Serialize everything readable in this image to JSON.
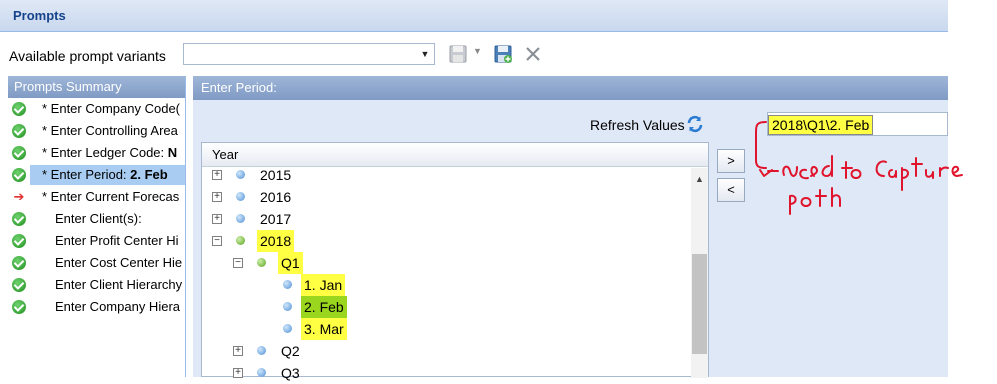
{
  "window": {
    "title": "Prompts"
  },
  "toolbar": {
    "variants_label": "Available prompt variants",
    "variant_value": "",
    "icons": [
      "save-icon",
      "dropdown-arrow-icon",
      "save-as-icon",
      "delete-icon"
    ]
  },
  "summary": {
    "header": "Prompts Summary",
    "items": [
      {
        "status": "ok",
        "label": "* Enter Company Code(",
        "value": ""
      },
      {
        "status": "ok",
        "label": "* Enter Controlling Area",
        "value": ""
      },
      {
        "status": "ok",
        "label": "* Enter Ledger Code: ",
        "value": "N"
      },
      {
        "status": "ok",
        "label": "* Enter Period: ",
        "value": "2. Feb"
      },
      {
        "status": "arrow",
        "label": "* Enter Current Forecas",
        "value": ""
      },
      {
        "status": "ok",
        "label": "Enter Client(s):",
        "value": ""
      },
      {
        "status": "ok",
        "label": "Enter Profit Center Hi",
        "value": ""
      },
      {
        "status": "ok",
        "label": "Enter Cost Center Hie",
        "value": ""
      },
      {
        "status": "ok",
        "label": "Enter Client Hierarchy",
        "value": ""
      },
      {
        "status": "ok",
        "label": "Enter Company Hiera",
        "value": ""
      }
    ]
  },
  "period": {
    "header": "Enter Period:",
    "refresh_label": "Refresh Values",
    "selected_path": "2018\\Q1\\2. Feb",
    "tree_header": "Year",
    "tree": [
      {
        "label": "2015",
        "level": 0,
        "expander": "+"
      },
      {
        "label": "2016",
        "level": 0,
        "expander": "+"
      },
      {
        "label": "2017",
        "level": 0,
        "expander": "+"
      },
      {
        "label": "2018",
        "level": 0,
        "expander": "-"
      },
      {
        "label": "Q1",
        "level": 1,
        "expander": "-"
      },
      {
        "label": "1. Jan",
        "level": 2,
        "expander": ""
      },
      {
        "label": "2. Feb",
        "level": 2,
        "expander": ""
      },
      {
        "label": "3. Mar",
        "level": 2,
        "expander": ""
      },
      {
        "label": "Q2",
        "level": 1,
        "expander": "+"
      },
      {
        "label": "Q3",
        "level": 1,
        "expander": "+"
      }
    ],
    "add_button": ">",
    "remove_button": "<"
  },
  "annotation": {
    "text": "Need to Capture path",
    "color": "#e0142c"
  },
  "colors": {
    "highlight": "#ffff44",
    "selected_green": "#9ad61d",
    "header_blue": "#7f9ac4"
  }
}
